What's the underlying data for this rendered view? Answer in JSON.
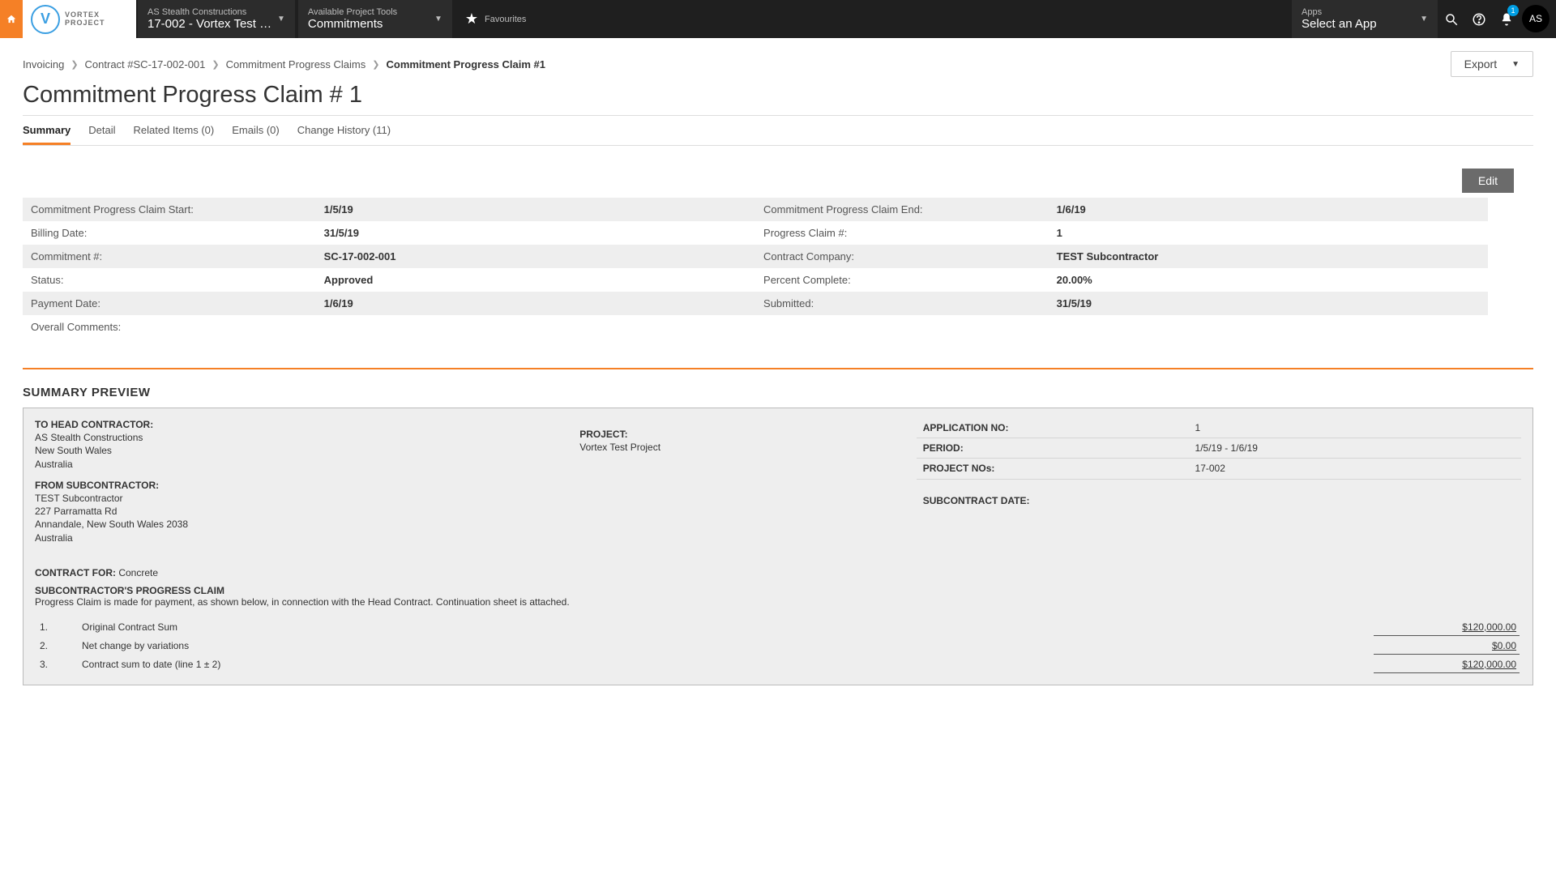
{
  "topbar": {
    "logo_line1": "VORTEX",
    "logo_line2": "PROJECT",
    "project_label": "AS Stealth Constructions",
    "project_value": "17-002 - Vortex Test Proj…",
    "tools_label": "Available Project Tools",
    "tools_value": "Commitments",
    "favourites": "Favourites",
    "apps_label": "Apps",
    "apps_value": "Select an App",
    "notif_count": "1",
    "avatar": "AS"
  },
  "breadcrumbs": {
    "items": [
      "Invoicing",
      "Contract #SC-17-002-001",
      "Commitment Progress Claims"
    ],
    "current": "Commitment Progress Claim #1"
  },
  "actions": {
    "export": "Export",
    "edit": "Edit"
  },
  "page_title": "Commitment Progress Claim # 1",
  "tabs": {
    "summary": "Summary",
    "detail": "Detail",
    "related": "Related Items (0)",
    "emails": "Emails (0)",
    "history": "Change History (11)"
  },
  "info": {
    "rows": [
      {
        "l1": "Commitment Progress Claim Start:",
        "v1": "1/5/19",
        "l2": "Commitment Progress Claim End:",
        "v2": "1/6/19"
      },
      {
        "l1": "Billing Date:",
        "v1": "31/5/19",
        "l2": "Progress Claim #:",
        "v2": "1"
      },
      {
        "l1": "Commitment #:",
        "v1": "SC-17-002-001",
        "l2": "Contract Company:",
        "v2": "TEST Subcontractor"
      },
      {
        "l1": "Status:",
        "v1": "Approved",
        "l2": "Percent Complete:",
        "v2": "20.00%"
      },
      {
        "l1": "Payment Date:",
        "v1": "1/6/19",
        "l2": "Submitted:",
        "v2": "31/5/19"
      }
    ],
    "comments_label": "Overall Comments:"
  },
  "preview": {
    "heading": "SUMMARY PREVIEW",
    "head": {
      "label": "TO HEAD CONTRACTOR:",
      "name": "AS Stealth Constructions",
      "region": "New South Wales",
      "country": "Australia"
    },
    "sub": {
      "label": "FROM SUBCONTRACTOR:",
      "name": "TEST Subcontractor",
      "addr1": "227 Parramatta Rd",
      "addr2": "Annandale, New South Wales 2038",
      "country": "Australia"
    },
    "project_label": "PROJECT:",
    "project_name": "Vortex Test Project",
    "meta": {
      "app_no_k": "APPLICATION NO:",
      "app_no_v": "1",
      "period_k": "PERIOD:",
      "period_v": "1/5/19 - 1/6/19",
      "pno_k": "PROJECT NOs:",
      "pno_v": "17-002"
    },
    "subcontract_date_label": "SUBCONTRACT DATE:",
    "contract_for_label": "CONTRACT FOR:",
    "contract_for_value": "Concrete",
    "claim_title": "SUBCONTRACTOR'S PROGRESS CLAIM",
    "claim_text": "Progress Claim is made for payment, as shown below, in connection with the Head Contract. Continuation sheet is attached.",
    "lines": [
      {
        "n": "1.",
        "d": "Original Contract Sum",
        "a": "$120,000.00"
      },
      {
        "n": "2.",
        "d": "Net change by variations",
        "a": "$0.00"
      },
      {
        "n": "3.",
        "d": "Contract sum to date (line 1 ± 2)",
        "a": "$120,000.00"
      }
    ]
  }
}
